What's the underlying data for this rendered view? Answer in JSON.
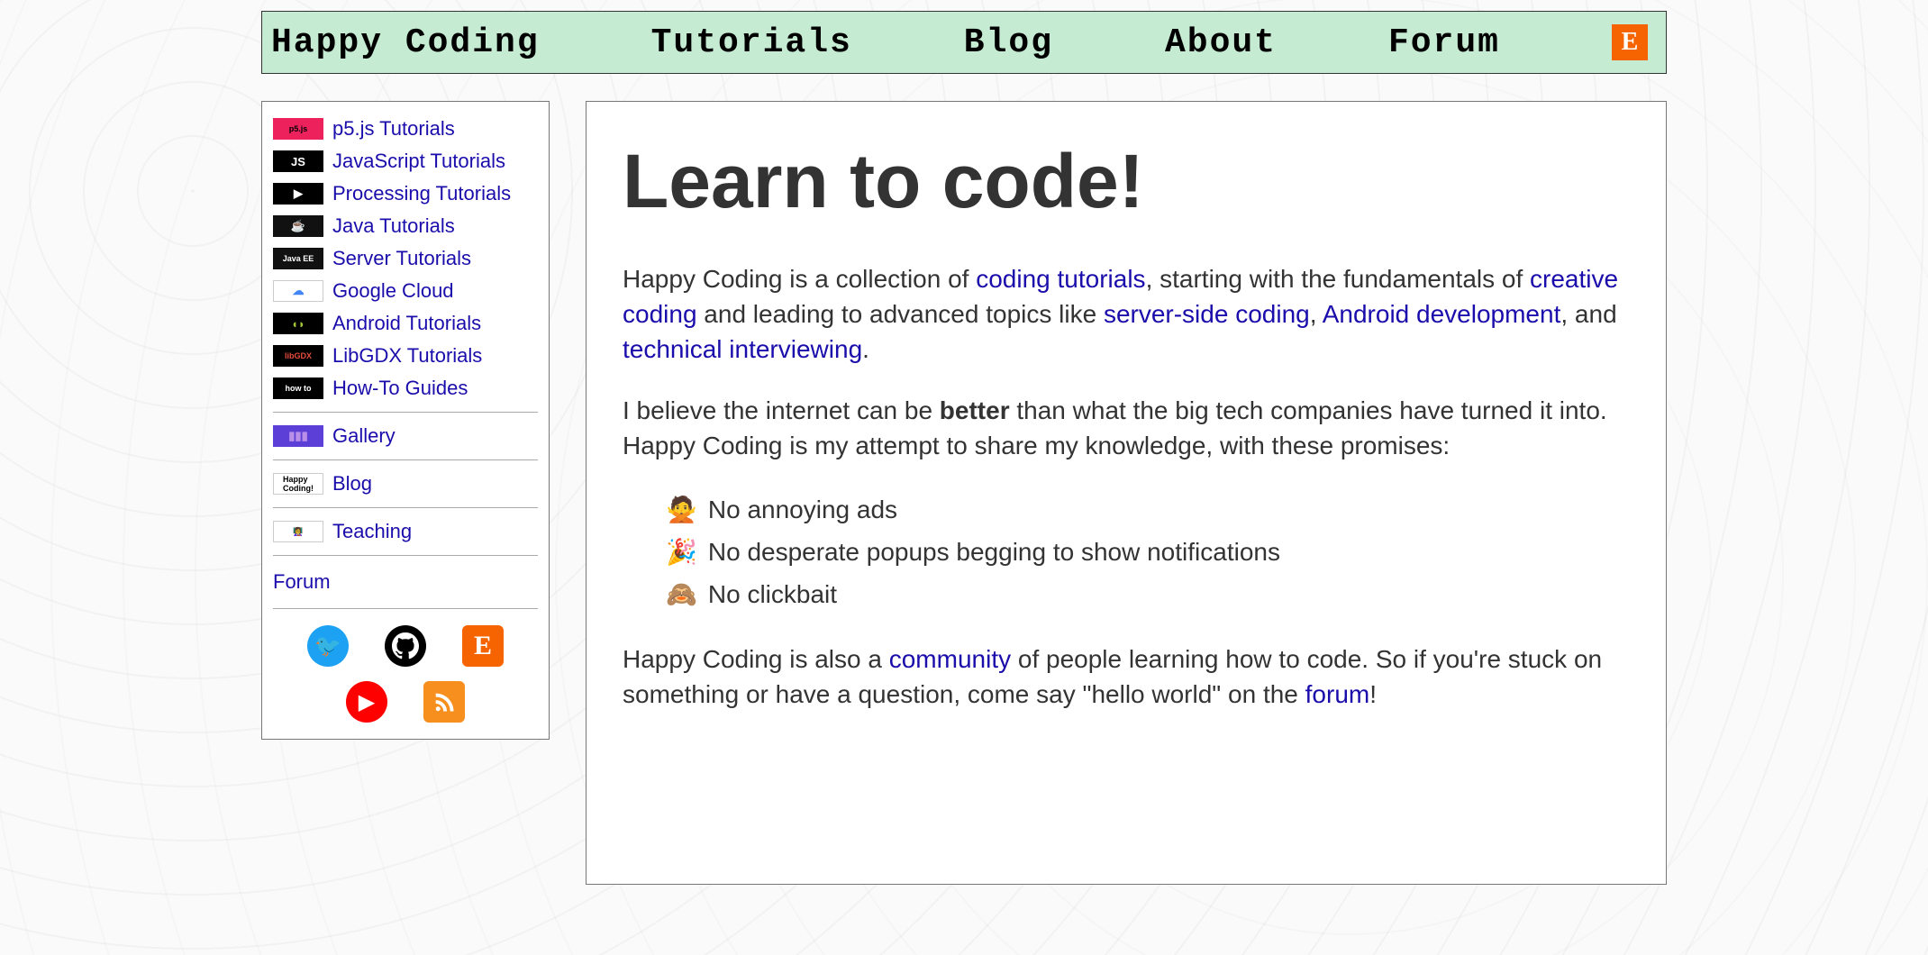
{
  "nav": {
    "brand": "Happy Coding",
    "items": [
      "Tutorials",
      "Blog",
      "About",
      "Forum"
    ]
  },
  "sidebar": {
    "groups": [
      [
        {
          "icon_text": "p5.js",
          "icon_bg": "#ed225d",
          "icon_fg": "#000",
          "label": "p5.js Tutorials"
        },
        {
          "icon_text": "JS",
          "icon_bg": "#000000",
          "icon_fg": "#fff",
          "label": "JavaScript Tutorials"
        },
        {
          "icon_text": "▶",
          "icon_bg": "#000000",
          "icon_fg": "#fff",
          "label": "Processing Tutorials"
        },
        {
          "icon_text": "☕",
          "icon_bg": "#111111",
          "icon_fg": "#d97a2e",
          "label": "Java Tutorials"
        },
        {
          "icon_text": "Java EE",
          "icon_bg": "#111111",
          "icon_fg": "#fff",
          "label": "Server Tutorials"
        },
        {
          "icon_text": "☁",
          "icon_bg": "#ffffff",
          "icon_fg": "#4285f4",
          "label": "Google Cloud"
        },
        {
          "icon_text": "◖◗",
          "icon_bg": "#000000",
          "icon_fg": "#a4c639",
          "label": "Android Tutorials"
        },
        {
          "icon_text": "libGDX",
          "icon_bg": "#000000",
          "icon_fg": "#e74c3c",
          "label": "LibGDX Tutorials"
        },
        {
          "icon_text": "how to",
          "icon_bg": "#000000",
          "icon_fg": "#fff",
          "label": "How-To Guides"
        }
      ],
      [
        {
          "icon_text": "▮▮▮",
          "icon_bg": "#5b3fd6",
          "icon_fg": "#b98fe8",
          "label": "Gallery"
        }
      ],
      [
        {
          "icon_text": "Happy\nCoding!",
          "icon_bg": "#ffffff",
          "icon_fg": "#000",
          "label": "Blog"
        }
      ],
      [
        {
          "icon_text": "👩‍🏫",
          "icon_bg": "#ffffff",
          "icon_fg": "#000",
          "label": "Teaching"
        }
      ]
    ],
    "forum": "Forum",
    "socials": [
      {
        "name": "twitter",
        "bg": "#1da1f2",
        "fg": "#fff",
        "glyph": "🐦",
        "shape": "circle"
      },
      {
        "name": "github",
        "bg": "#000000",
        "fg": "#fff",
        "glyph": "",
        "shape": "circle"
      },
      {
        "name": "etsy",
        "bg": "#f56400",
        "fg": "#fff",
        "glyph": "E",
        "shape": "square"
      },
      {
        "name": "youtube",
        "bg": "#ff0000",
        "fg": "#fff",
        "glyph": "▶",
        "shape": "circle"
      },
      {
        "name": "rss",
        "bg": "#f78f1e",
        "fg": "#fff",
        "glyph": "",
        "shape": "square"
      }
    ]
  },
  "article": {
    "title": "Learn to code!",
    "p1_parts": [
      {
        "t": "Happy Coding is a collection of "
      },
      {
        "t": "coding tutorials",
        "link": true
      },
      {
        "t": ", starting with the fundamentals of "
      },
      {
        "t": "creative coding",
        "link": true
      },
      {
        "t": " and leading to advanced topics like "
      },
      {
        "t": "server-side coding",
        "link": true
      },
      {
        "t": ", "
      },
      {
        "t": "Android development",
        "link": true
      },
      {
        "t": ", and "
      },
      {
        "t": "technical interviewing",
        "link": true
      },
      {
        "t": "."
      }
    ],
    "p2_before": "I believe the internet can be ",
    "p2_bold": "better",
    "p2_after": " than what the big tech companies have turned it into. Happy Coding is my attempt to share my knowledge, with these promises:",
    "promises": [
      {
        "emoji": "🙅",
        "text": "No annoying ads"
      },
      {
        "emoji": "🎉",
        "text": "No desperate popups begging to show notifications"
      },
      {
        "emoji": "🙈",
        "text": "No clickbait"
      }
    ],
    "p3_parts": [
      {
        "t": "Happy Coding is also a "
      },
      {
        "t": "community",
        "link": true
      },
      {
        "t": " of people learning how to code. So if you're stuck on something or have a question, come say \"hello world\" on the "
      },
      {
        "t": "forum",
        "link": true
      },
      {
        "t": "!"
      }
    ]
  }
}
